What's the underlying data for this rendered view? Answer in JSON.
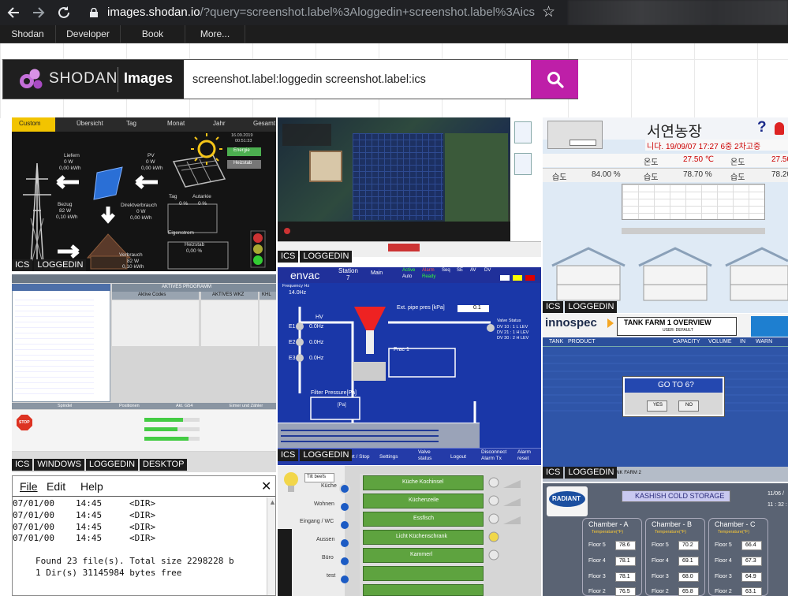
{
  "browser": {
    "url_host": "images.shodan.io",
    "url_path": "/?query=screenshot.label%3Aloggedin+screenshot.label%3Aics",
    "icons": [
      "back-icon",
      "forward-icon",
      "reload-icon",
      "lock-icon",
      "star-icon"
    ]
  },
  "nav": {
    "items": [
      "Shodan",
      "Developer",
      "Book",
      "More..."
    ]
  },
  "search": {
    "brand": "SHODAN",
    "section": "Images",
    "query": "screenshot.label:loggedin screenshot.label:ics"
  },
  "colors": {
    "accent": "#be1fa8",
    "chrome": "#202124",
    "menubar": "#1d1d1d"
  },
  "results": [
    {
      "tags": [
        "ICS",
        "LOGGEDIN"
      ],
      "labels": [
        "Custom",
        "Übersicht",
        "Tag",
        "Monat",
        "Jahr",
        "Gesamt",
        "Liefern",
        "0 W",
        "0,00 kWh",
        "PV",
        "0 W",
        "0,00 kWh",
        "16.09.2019",
        "00:51:33",
        "Energie",
        "Heizstab",
        "Direktverbrauch",
        "0 W",
        "0,00 kWh",
        "Tag",
        "Autarkie",
        "0 %",
        "0 %",
        "Eigenstrom",
        "Bezug",
        "82 W",
        "0,10 kWh",
        "Verbrauch",
        "82 W",
        "0,10 kWh",
        "Heizstab",
        "0,00 %"
      ]
    },
    {
      "tags": [
        "ICS",
        "LOGGEDIN"
      ],
      "labels": []
    },
    {
      "tags": [
        "ICS",
        "LOGGEDIN"
      ],
      "labels": [
        "서연농장",
        "?",
        "습도",
        "84.00 %",
        "습도",
        "78.70 %",
        "습도",
        "78.20",
        "온도",
        "27.50 ℃",
        "온도",
        "27.50"
      ]
    },
    {
      "tags": [
        "ICS",
        "WINDOWS",
        "LOGGEDIN",
        "DESKTOP"
      ],
      "labels": [
        "AKTIVES PROGRAMM",
        "Aktive Codes",
        "AKTIVES WKZ",
        "KHL",
        "Spindel",
        "Positionen",
        "Akt. G54",
        "Eimer und Zähler",
        "STOP"
      ]
    },
    {
      "tags": [
        "ICS",
        "LOGGEDIN"
      ],
      "labels": [
        "envac",
        "Station",
        "7",
        "Main",
        "Active",
        "Auto",
        "Alarm",
        "Ready",
        "Seq",
        "SE",
        "AV",
        "DV",
        "Frequency Hz",
        "14.0Hz",
        "HV",
        "E1",
        "0.0Hz",
        "E2",
        "0.0Hz",
        "E3",
        "0.0Hz",
        "Ext. pipe pres [kPa]",
        "0.1",
        "Valve Status",
        "DV 10 : 1 L LEV",
        "DV 21 : 1 H LEV",
        "DV 30 : 2 H LEV",
        "Frac 1",
        "Filter Pressure[Pa]",
        "[Pa]",
        "Start / Stop",
        "Settings",
        "Valve status",
        "Logout",
        "Disconnect Alarm Tx",
        "Alarm reset"
      ]
    },
    {
      "tags": [
        "ICS",
        "LOGGEDIN"
      ],
      "labels": [
        "innospec",
        "TANK FARM 1 OVERVIEW",
        "USER: DEFAULT",
        "TANK",
        "PRODUCT",
        "CAPACITY",
        "VOLUME",
        "IN",
        "WARN",
        "GO TO 6?",
        "YES",
        "NO",
        "TANK FARM 2"
      ]
    },
    {
      "tags": [],
      "labels": [
        "File",
        "Edit",
        "Help",
        "07/01/00",
        "14:45",
        "<DIR>",
        "Found 23 file(s). Total size 2298228 b",
        "1 Dir(s) 31145984 bytes free"
      ]
    },
    {
      "tags": [],
      "labels": [
        "Tilt beefs",
        "Küche",
        "Wohnen",
        "Eingang / WC",
        "Aussen",
        "Büro",
        "test",
        "Küche Kochinsel",
        "Küchenzeile",
        "Essfisch",
        "Licht Küchenschrank",
        "Kammerl"
      ]
    },
    {
      "tags": [],
      "labels": [
        "RADIANT",
        "KASHISH COLD STORAGE",
        "11/06 /",
        "11 : 32 :",
        "Chamber - A",
        "Chamber - B",
        "Chamber - C",
        "Temperature(°F)",
        "Temperature(°F)",
        "Temperature(°F)",
        "Floor 5",
        "78.6",
        "Floor 5",
        "70.2",
        "Floor 5",
        "66.4",
        "Floor 4",
        "78.1",
        "Floor 4",
        "69.1",
        "Floor 4",
        "67.3",
        "Floor 3",
        "78.1",
        "Floor 3",
        "68.0",
        "Floor 3",
        "64.9",
        "Floor 2",
        "76.5",
        "Floor 2",
        "65.8",
        "Floor 2",
        "63.1"
      ]
    }
  ]
}
